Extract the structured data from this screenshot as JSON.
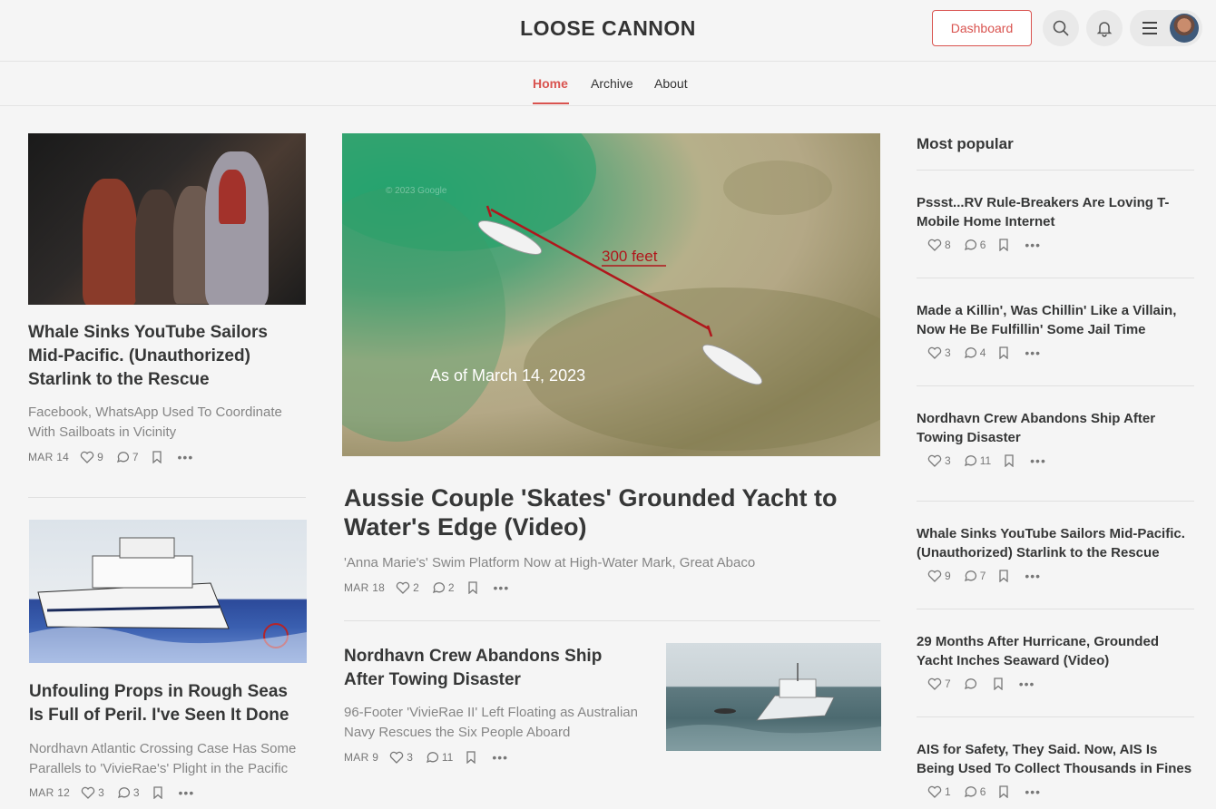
{
  "header": {
    "site_title": "LOOSE CANNON",
    "dashboard_label": "Dashboard",
    "nav": [
      {
        "label": "Home",
        "active": true
      },
      {
        "label": "Archive",
        "active": false
      },
      {
        "label": "About",
        "active": false
      }
    ],
    "accent_color": "#d9534f"
  },
  "left_column": [
    {
      "title": "Whale Sinks YouTube Sailors Mid-Pacific. (Unauthorized) Starlink to the Rescue",
      "subtitle": "Facebook, WhatsApp Used To Coordinate With Sailboats in Vicinity",
      "date": "MAR 14",
      "likes": "9",
      "comments": "7"
    },
    {
      "title": "Unfouling Props in Rough Seas Is Full of Peril. I've Seen It Done",
      "subtitle": "Nordhavn Atlantic Crossing Case Has Some Parallels to 'VivieRae's' Plight in the Pacific",
      "date": "MAR 12",
      "likes": "3",
      "comments": "3"
    }
  ],
  "featured": {
    "image_caption": "As of March 14, 2023",
    "image_measure": "300 feet",
    "image_watermark": "© 2023 Google",
    "title": "Aussie Couple 'Skates' Grounded Yacht to Water's Edge (Video)",
    "subtitle": "'Anna Marie's' Swim Platform Now at High-Water Mark, Great Abaco",
    "date": "MAR 18",
    "likes": "2",
    "comments": "2"
  },
  "secondary": {
    "title": "Nordhavn Crew Abandons Ship After Towing Disaster",
    "subtitle": "96-Footer 'VivieRae II' Left Floating as Australian Navy Rescues the Six People Aboard",
    "date": "MAR 9",
    "likes": "3",
    "comments": "11"
  },
  "popular": {
    "heading": "Most popular",
    "items": [
      {
        "title": "Pssst...RV Rule-Breakers Are Loving T-Mobile Home Internet",
        "likes": "8",
        "comments": "6"
      },
      {
        "title": "Made a Killin', Was Chillin' Like a Villain, Now He Be Fulfillin' Some Jail Time",
        "likes": "3",
        "comments": "4"
      },
      {
        "title": "Nordhavn Crew Abandons Ship After Towing Disaster",
        "likes": "3",
        "comments": "11"
      },
      {
        "title": "Whale Sinks YouTube Sailors Mid-Pacific. (Unauthorized) Starlink to the Rescue",
        "likes": "9",
        "comments": "7"
      },
      {
        "title": "29 Months After Hurricane, Grounded Yacht Inches Seaward (Video)",
        "likes": "7",
        "comments": ""
      },
      {
        "title": "AIS for Safety, They Said. Now, AIS Is Being Used To Collect Thousands in Fines",
        "likes": "1",
        "comments": "6"
      }
    ]
  }
}
